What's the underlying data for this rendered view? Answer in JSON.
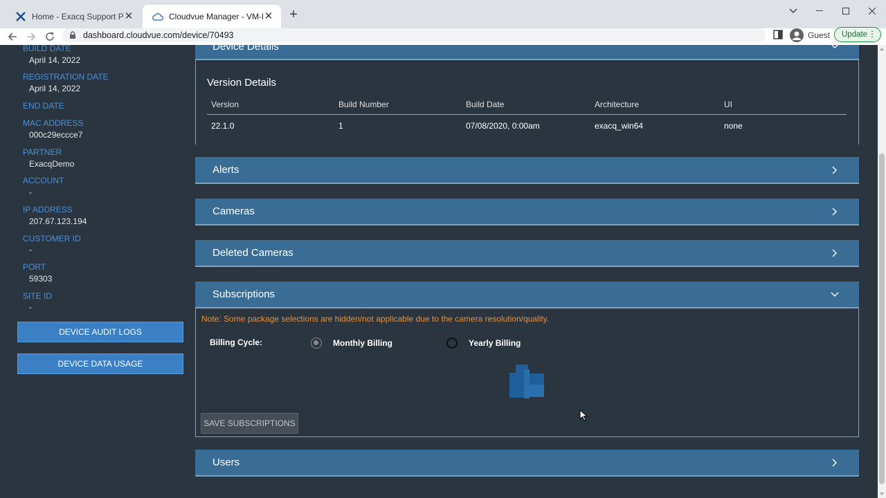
{
  "browser": {
    "tabs": [
      {
        "title": "Home - Exacq Support Portal",
        "active": false
      },
      {
        "title": "Cloudvue Manager - VM-EX-Win",
        "active": true
      }
    ],
    "url": "dashboard.cloudvue.com/device/70493",
    "profile_label": "Guest",
    "update_label": "Update"
  },
  "sidebar": {
    "fields": [
      {
        "label": "BUILD DATE",
        "value": "April 14, 2022"
      },
      {
        "label": "REGISTRATION DATE",
        "value": "April 14, 2022"
      },
      {
        "label": "END DATE",
        "value": ""
      },
      {
        "label": "MAC ADDRESS",
        "value": "000c29eccce7"
      },
      {
        "label": "PARTNER",
        "value": "ExacqDemo"
      },
      {
        "label": "ACCOUNT",
        "value": "-"
      },
      {
        "label": "IP ADDRESS",
        "value": "207.67.123.194"
      },
      {
        "label": "CUSTOMER ID",
        "value": "-"
      },
      {
        "label": "PORT",
        "value": "59303"
      },
      {
        "label": "SITE ID",
        "value": "-"
      }
    ],
    "buttons": {
      "audit_logs": "DEVICE AUDIT LOGS",
      "data_usage": "DEVICE DATA USAGE"
    }
  },
  "sections": {
    "device_details": "Device Details",
    "alerts": "Alerts",
    "cameras": "Cameras",
    "deleted_cameras": "Deleted Cameras",
    "subscriptions": "Subscriptions",
    "users": "Users"
  },
  "version_details": {
    "title": "Version Details",
    "headers": [
      "Version",
      "Build Number",
      "Build Date",
      "Architecture",
      "UI"
    ],
    "row": [
      "22.1.0",
      "1",
      "07/08/2020, 0:00am",
      "exacq_win64",
      "none"
    ]
  },
  "subscriptions": {
    "note": "Note: Some package selections are hidden/not applicable due to the camera resolution/quality.",
    "billing_cycle_label": "Billing Cycle:",
    "options": [
      {
        "label": "Monthly Billing",
        "selected": true
      },
      {
        "label": "Yearly Billing",
        "selected": false
      }
    ],
    "save_label": "SAVE SUBSCRIPTIONS"
  },
  "colors": {
    "page_bg": "#2b3540",
    "section_header": "#3a6d96",
    "sidebar_label": "#4a90d9",
    "note": "#e8903a",
    "button": "#3b7fc4"
  }
}
